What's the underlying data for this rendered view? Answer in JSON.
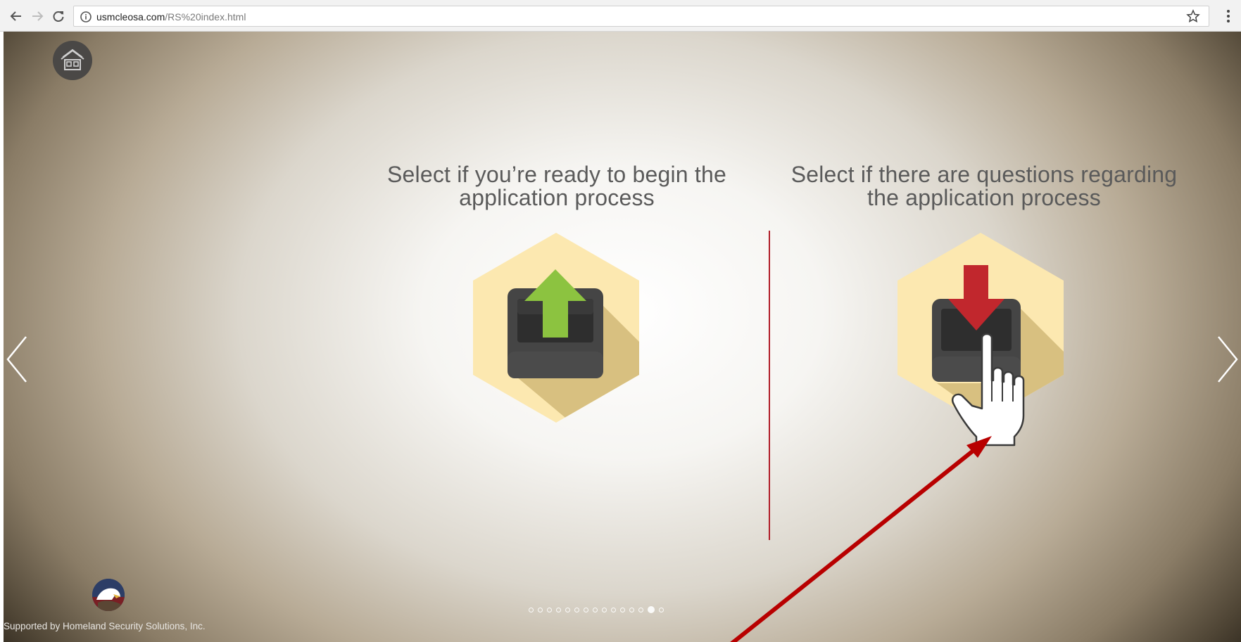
{
  "browser": {
    "url_domain": "usmcleosa.com",
    "url_path": "/RS%20index.html",
    "icons": [
      "back-icon",
      "forward-icon",
      "reload-icon",
      "info-icon",
      "bookmark-star-icon",
      "menu-icon"
    ]
  },
  "slide": {
    "left_option": {
      "heading_line1": "Select if you’re ready to begin the",
      "heading_line2": "application process",
      "icon": "upload-icon",
      "arrow_color": "#8cc340"
    },
    "right_option": {
      "heading_line1": "Select if there are questions regarding",
      "heading_line2": "the application process",
      "icon": "download-icon",
      "arrow_color": "#c1272d"
    },
    "divider_color": "#b01c27",
    "hex_color": "#fce8b0",
    "shadow_color": "#d8c080",
    "footer_text": "Supported by Homeland Security Solutions, Inc.",
    "pagination": {
      "total": 15,
      "active": 14
    }
  }
}
